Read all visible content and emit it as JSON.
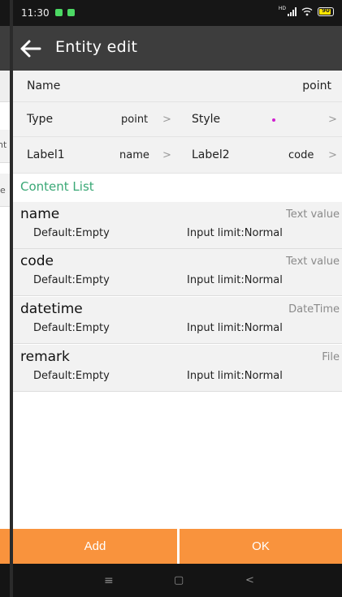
{
  "status_bar": {
    "time": "11:30",
    "signal_label": "HD",
    "battery_text": "90",
    "battery_level": 0.9
  },
  "toolbar": {
    "title": "Entity edit",
    "back_icon": "arrow-left-icon"
  },
  "background_screen": {
    "fragments": [
      "nt",
      "le"
    ]
  },
  "form": {
    "name": {
      "label": "Name",
      "value": "point"
    },
    "type": {
      "label": "Type",
      "value": "point",
      "chevron": ">"
    },
    "style": {
      "label": "Style",
      "dot_color": "#d11fd1",
      "chevron": ">"
    },
    "label1": {
      "label": "Label1",
      "value": "name",
      "chevron": ">"
    },
    "label2": {
      "label": "Label2",
      "value": "code",
      "chevron": ">"
    }
  },
  "content_list": {
    "title": "Content List",
    "items": [
      {
        "name": "name",
        "type": "Text value",
        "default": "Default:Empty",
        "limit": "Input limit:Normal"
      },
      {
        "name": "code",
        "type": "Text value",
        "default": "Default:Empty",
        "limit": "Input limit:Normal"
      },
      {
        "name": "datetime",
        "type": "DateTime",
        "default": "Default:Empty",
        "limit": "Input limit:Normal"
      },
      {
        "name": "remark",
        "type": "File",
        "default": "Default:Empty",
        "limit": "Input limit:Normal"
      }
    ]
  },
  "buttons": {
    "add": "Add",
    "ok": "OK"
  },
  "nav_bar": {
    "menu": "≡",
    "home": "▢",
    "back": "<"
  },
  "colors": {
    "accent": "#f9933d",
    "section_title": "#3aa876",
    "toolbar": "#3d3d3d"
  }
}
